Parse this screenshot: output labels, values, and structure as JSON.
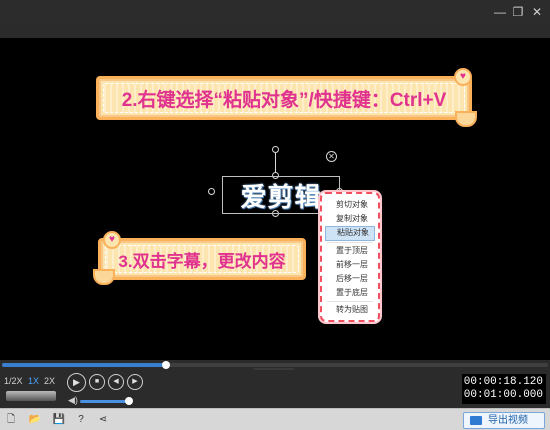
{
  "window": {
    "minimize_glyph": "—",
    "restore_glyph": "❐",
    "close_glyph": "✕"
  },
  "preview": {
    "banner_top_text": "2.右键选择“粘贴对象”/快捷键：Ctrl+V",
    "banner_bottom_text": "3.双击字幕，更改内容",
    "subtitle_text": "爱剪辑"
  },
  "context_menu": {
    "items": [
      "剪切对象",
      "复制对象",
      "粘贴对象",
      "置于顶层",
      "前移一层",
      "后移一层",
      "置于底层",
      "转为贴图"
    ],
    "active_index": 2
  },
  "player": {
    "speeds": [
      "1/2X",
      "1X",
      "2X"
    ],
    "active_speed": "1X",
    "progress_fraction": 0.3,
    "volume_fraction": 0.95,
    "current_time": "00:00:18.120",
    "total_time": "00:01:00.000"
  },
  "toolbar": {
    "export_label": "导出视频"
  },
  "colors": {
    "accent": "#3a7fcf",
    "banner_text": "#e0328f",
    "banner_border": "#fbb05a",
    "menu_border": "#f04f5f"
  }
}
